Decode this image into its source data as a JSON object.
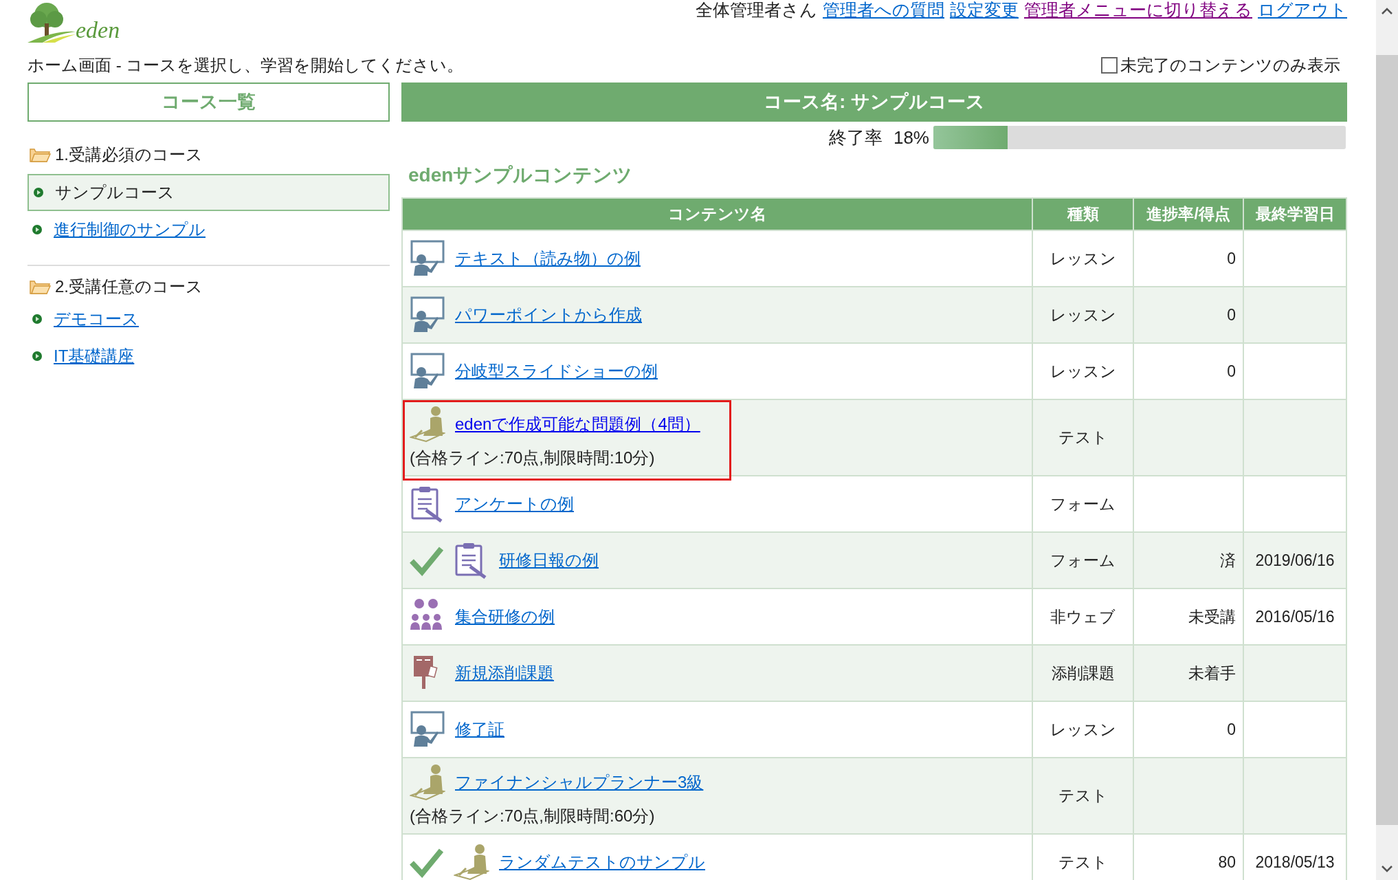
{
  "logo": "eden",
  "header": {
    "user": "全体管理者さん",
    "links": [
      {
        "label": "管理者への質問",
        "visited": false
      },
      {
        "label": "設定変更",
        "visited": false
      },
      {
        "label": "管理者メニューに切り替える",
        "visited": true
      },
      {
        "label": "ログアウト",
        "visited": false
      }
    ]
  },
  "instruction": "ホーム画面 - コースを選択し、学習を開始してください。",
  "filter": {
    "label": "未完了のコンテンツのみ表示",
    "checked": false
  },
  "sidebar": {
    "title": "コース一覧",
    "groups": [
      {
        "label": "1.受講必須のコース",
        "items": [
          {
            "label": "サンプルコース",
            "selected": true
          },
          {
            "label": "進行制御のサンプル",
            "selected": false
          }
        ]
      },
      {
        "label": "2.受講任意のコース",
        "items": [
          {
            "label": "デモコース",
            "selected": false
          },
          {
            "label": "IT基礎講座",
            "selected": false
          }
        ]
      }
    ]
  },
  "course": {
    "title": "コース名: サンプルコース",
    "progress_label": "終了率",
    "progress_value": "18%",
    "level": 0.18,
    "section": "edenサンプルコンテンツ",
    "columns": [
      "コンテンツ名",
      "種類",
      "進捗率/得点",
      "最終学習日"
    ],
    "rows": [
      {
        "kind": "lesson",
        "title": "テキスト（読み物）の例",
        "completed": false,
        "highlighted": false,
        "type": "レッスン",
        "progress": "0"
      },
      {
        "kind": "lesson",
        "title": "パワーポイントから作成",
        "completed": false,
        "highlighted": false,
        "type": "レッスン",
        "progress": "0"
      },
      {
        "kind": "lesson",
        "title": "分岐型スライドショーの例",
        "completed": false,
        "highlighted": false,
        "type": "レッスン",
        "progress": "0"
      },
      {
        "kind": "test",
        "title": "edenで作成可能な問題例（4問）",
        "note": "(合格ライン:70点,制限時間:10分)",
        "completed": false,
        "highlighted": true,
        "type": "テスト"
      },
      {
        "kind": "form",
        "title": "アンケートの例",
        "completed": false,
        "highlighted": false,
        "type": "フォーム"
      },
      {
        "kind": "form",
        "title": "研修日報の例",
        "completed": true,
        "highlighted": false,
        "type": "フォーム",
        "progress": "済",
        "date": "2019/06/16"
      },
      {
        "kind": "group",
        "title": "集合研修の例",
        "completed": false,
        "highlighted": false,
        "type": "非ウェブ",
        "progress": "未受講",
        "date": "2016/05/16"
      },
      {
        "kind": "post",
        "title": "新規添削課題",
        "completed": false,
        "highlighted": false,
        "type": "添削課題",
        "progress": "未着手"
      },
      {
        "kind": "lesson",
        "title": "修了証",
        "completed": false,
        "highlighted": false,
        "type": "レッスン",
        "progress": "0"
      },
      {
        "kind": "test",
        "title": "ファイナンシャルプランナー3級",
        "note": "(合格ライン:70点,制限時間:60分)",
        "completed": false,
        "highlighted": false,
        "type": "テスト"
      },
      {
        "kind": "test",
        "title": "ランダムテストのサンプル",
        "completed": true,
        "highlighted": false,
        "type": "テスト",
        "progress": "80",
        "date": "2018/05/13"
      }
    ]
  }
}
